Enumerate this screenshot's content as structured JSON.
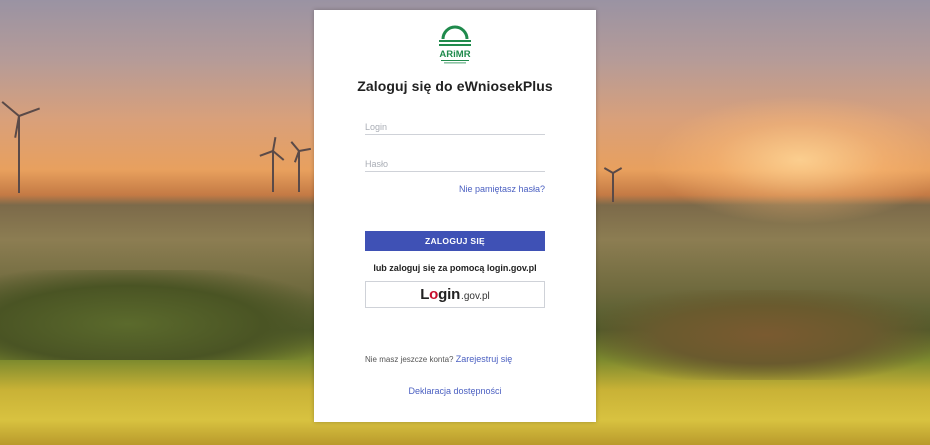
{
  "logo": {
    "text": "ARiMR"
  },
  "title": "Zaloguj się do eWniosekPlus",
  "form": {
    "login_placeholder": "Login",
    "password_placeholder": "Hasło",
    "forgot_password": "Nie pamiętasz hasła?",
    "submit_label": "ZALOGUJ SIĘ"
  },
  "alternative": {
    "text": "lub zaloguj się za pomocą login.gov.pl",
    "button": {
      "brand_lo": "L",
      "brand_o": "o",
      "brand_gin": "gin",
      "brand_domain": ".gov.pl"
    }
  },
  "footer": {
    "no_account": "Nie masz jeszcze konta?",
    "register": "Zarejestruj się",
    "accessibility": "Deklaracja dostępności"
  },
  "colors": {
    "primary": "#3f51b5",
    "link": "#4a5fc1",
    "logo_green": "#1f8a4c",
    "login_gov_red": "#c8102e"
  }
}
